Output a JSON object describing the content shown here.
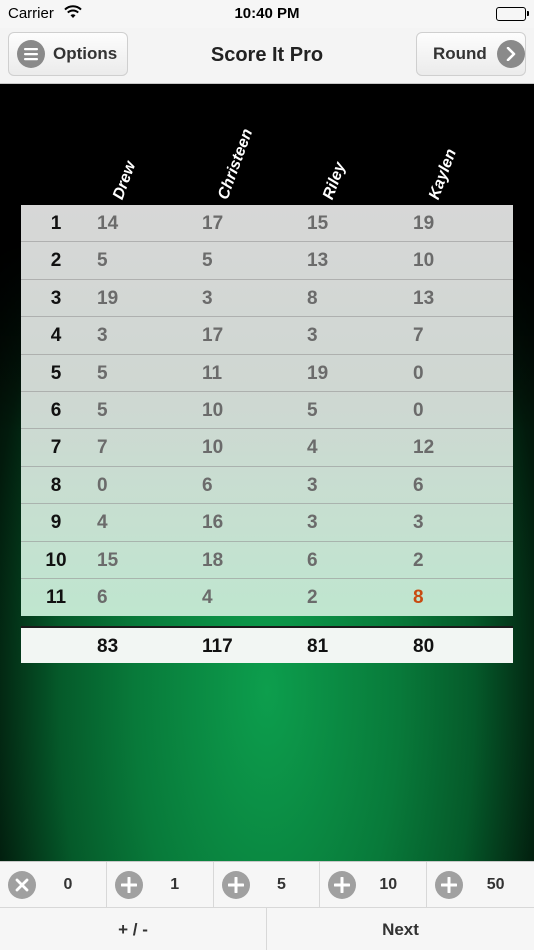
{
  "status_bar": {
    "carrier": "Carrier",
    "time": "10:40 PM"
  },
  "nav": {
    "title": "Score It Pro",
    "options_label": "Options",
    "round_label": "Round",
    "options_icon": "menu-icon",
    "round_icon": "chevron-right-icon"
  },
  "players": [
    "Drew",
    "Christeen",
    "Riley",
    "Kaylen"
  ],
  "rounds": [
    {
      "round": "1",
      "scores": [
        "14",
        "17",
        "15",
        "19"
      ]
    },
    {
      "round": "2",
      "scores": [
        "5",
        "5",
        "13",
        "10"
      ]
    },
    {
      "round": "3",
      "scores": [
        "19",
        "3",
        "8",
        "13"
      ]
    },
    {
      "round": "4",
      "scores": [
        "3",
        "17",
        "3",
        "7"
      ]
    },
    {
      "round": "5",
      "scores": [
        "5",
        "11",
        "19",
        "0"
      ]
    },
    {
      "round": "6",
      "scores": [
        "5",
        "10",
        "5",
        "0"
      ]
    },
    {
      "round": "7",
      "scores": [
        "7",
        "10",
        "4",
        "12"
      ]
    },
    {
      "round": "8",
      "scores": [
        "0",
        "6",
        "3",
        "6"
      ]
    },
    {
      "round": "9",
      "scores": [
        "4",
        "16",
        "3",
        "3"
      ]
    },
    {
      "round": "10",
      "scores": [
        "15",
        "18",
        "6",
        "2"
      ]
    },
    {
      "round": "11",
      "scores": [
        "6",
        "4",
        "2",
        "8"
      ]
    }
  ],
  "highlight": {
    "round_index": 10,
    "player_index": 3,
    "color": "#c84a10"
  },
  "totals": [
    "83",
    "117",
    "81",
    "80"
  ],
  "increments": [
    {
      "icon": "clear-icon",
      "value": "0"
    },
    {
      "icon": "plus-icon",
      "value": "1"
    },
    {
      "icon": "plus-icon",
      "value": "5"
    },
    {
      "icon": "plus-icon",
      "value": "10"
    },
    {
      "icon": "plus-icon",
      "value": "50"
    }
  ],
  "actions": {
    "plus_minus": "+ / -",
    "next": "Next"
  },
  "colors": {
    "felt_green": "#0d9e4d",
    "accent_orange": "#c84a10"
  }
}
